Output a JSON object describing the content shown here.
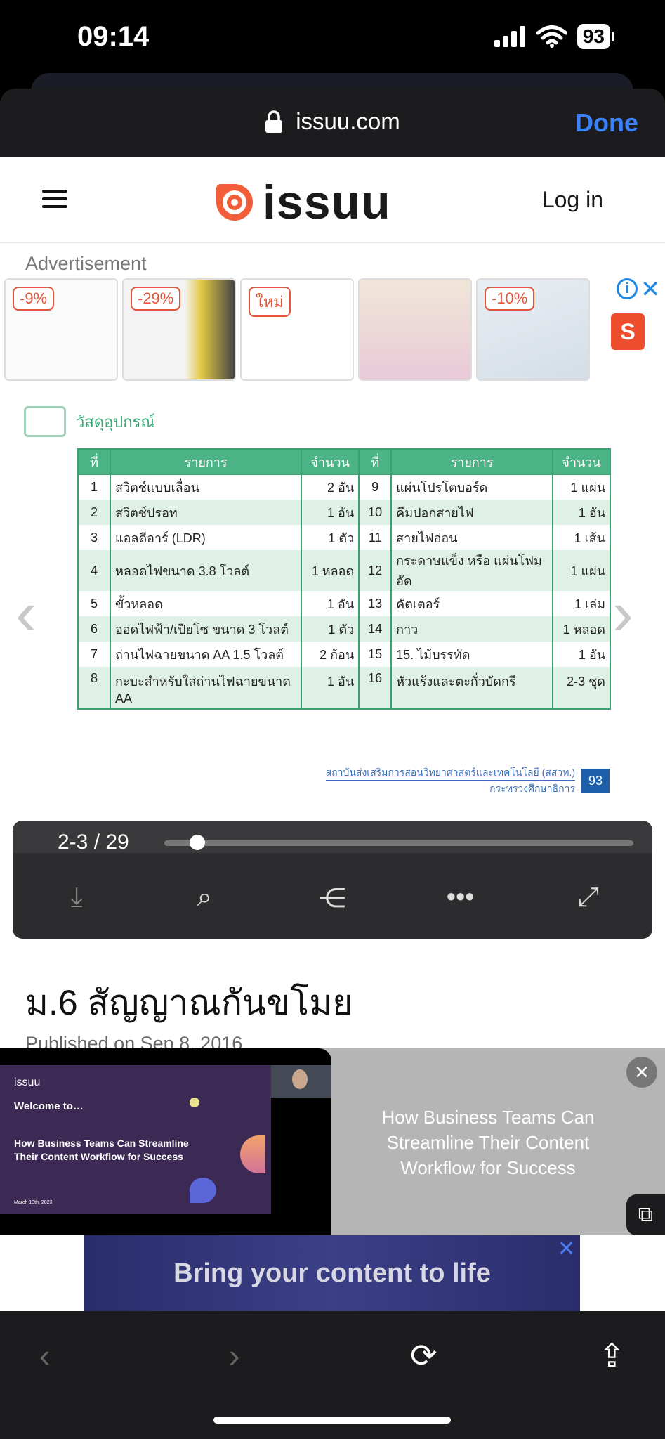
{
  "status_bar": {
    "time": "09:14",
    "battery": "93"
  },
  "browser": {
    "url": "issuu.com",
    "done_label": "Done"
  },
  "site_header": {
    "logo_text": "issuu",
    "login_label": "Log in"
  },
  "advertisement": {
    "label": "Advertisement",
    "items": [
      {
        "badge": "-9%"
      },
      {
        "badge": "-29%"
      },
      {
        "badge": "ใหม่"
      },
      {
        "badge": ""
      },
      {
        "badge": "-10%"
      }
    ],
    "shop_icon": "shopee-bag-icon"
  },
  "document": {
    "heading": "วัสดุอุปกรณ์",
    "table_headers": [
      "ที่",
      "รายการ",
      "จำนวน",
      "ที่",
      "รายการ",
      "จำนวน"
    ],
    "rows": [
      [
        "1",
        "สวิตช์แบบเลื่อน",
        "2 อัน",
        "9",
        "แผ่นโปรโตบอร์ด",
        "1 แผ่น"
      ],
      [
        "2",
        "สวิตช์ปรอท",
        "1 อัน",
        "10",
        "คีมปอกสายไฟ",
        "1 อัน"
      ],
      [
        "3",
        "แอลดีอาร์ (LDR)",
        "1 ตัว",
        "11",
        "สายไฟอ่อน",
        "1 เส้น"
      ],
      [
        "4",
        "หลอดไฟขนาด 3.8 โวลต์",
        "1 หลอด",
        "12",
        "กระดาษแข็ง หรือ แผ่นโฟมอัด",
        "1 แผ่น"
      ],
      [
        "5",
        "ขั้วหลอด",
        "1 อัน",
        "13",
        "คัตเตอร์",
        "1 เล่ม"
      ],
      [
        "6",
        "ออดไฟฟ้า/เปียโซ ขนาด 3 โวลต์",
        "1 ตัว",
        "14",
        "กาว",
        "1 หลอด"
      ],
      [
        "7",
        "ถ่านไฟฉายขนาด AA  1.5 โวลต์",
        "2 ก้อน",
        "15",
        "15. ไม้บรรทัด",
        "1 อัน"
      ],
      [
        "8",
        "กะบะสำหรับใส่ถ่านไฟฉายขนาด AA",
        "1 อัน",
        "16",
        "หัวแร้งและตะกั่วบัดกรี",
        "2-3 ชุด"
      ]
    ],
    "footer_institution": "สถาบันส่งเสริมการสอนวิทยาศาสตร์และเทคโนโลยี (สสวท.)",
    "footer_ministry": "กระทรวงศึกษาธิการ",
    "page_number": "93"
  },
  "reader": {
    "page_counter": "2-3 / 29",
    "progress": 0.07
  },
  "article": {
    "title": "ม.6 สัญญาณกันขโมย",
    "published": "Published on Sep 8, 2016"
  },
  "video": {
    "logo": "issuu",
    "welcome": "Welcome to…",
    "slide_title": "How Business Teams Can Streamline Their Content Workflow for Success",
    "slide_date": "March 13th, 2023",
    "caption": "How Business Teams Can Streamline Their Content Workflow for Success"
  },
  "banner": {
    "text": "Bring your content to life"
  }
}
